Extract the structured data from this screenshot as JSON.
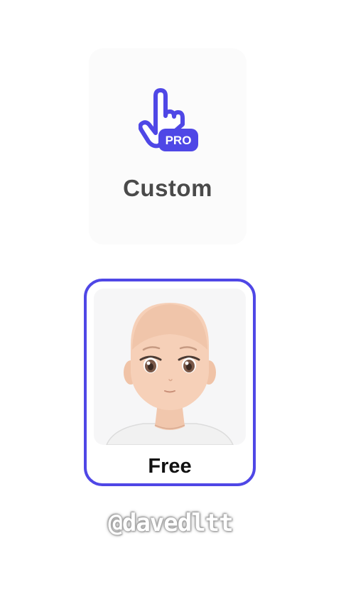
{
  "options": {
    "custom": {
      "label": "Custom",
      "badge": "PRO",
      "icon": "hand-pointer-icon",
      "accent": "#4f47e6"
    },
    "free": {
      "label": "Free",
      "icon": "avatar-face",
      "selected": true,
      "border_color": "#4f47e6"
    }
  },
  "watermark": {
    "text": "@davedltt"
  }
}
